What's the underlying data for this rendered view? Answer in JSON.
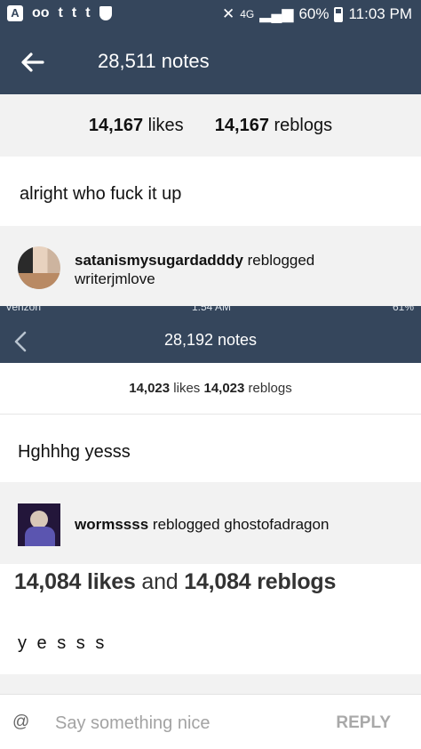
{
  "status_bar": {
    "left_icons": [
      "tumblr-app-icon",
      "voicemail-icon",
      "tumblr-t-icon",
      "tumblr-t-icon",
      "tumblr-t-icon",
      "shield-icon"
    ],
    "network": "4G",
    "battery": "60%",
    "time": "11:03 PM"
  },
  "header1": {
    "title": "28,511 notes"
  },
  "likes1": {
    "likes_count": "14,167",
    "likes_label": "likes",
    "reblogs_count": "14,167",
    "reblogs_label": "reblogs"
  },
  "post1": {
    "text": "alright who fuck it up"
  },
  "reblog1": {
    "user": "satanismysugardadddy",
    "verb": "reblogged",
    "source": "writerjmlove"
  },
  "status_bar2": {
    "carrier": "Verizon",
    "time": "1:54 AM",
    "battery": "61%"
  },
  "header2": {
    "title": "28,192 notes"
  },
  "likes2": {
    "likes_count": "14,023",
    "likes_label": "likes",
    "reblogs_count": "14,023",
    "reblogs_label": "reblogs"
  },
  "post2": {
    "text": "Hghhhg yesss"
  },
  "reblog2": {
    "user": "wormssss",
    "verb": "reblogged",
    "source": "ghostofadragon"
  },
  "likes3": {
    "likes_count": "14,084",
    "likes_label": "likes",
    "and": "and",
    "reblogs_count": "14,084",
    "reblogs_label": "reblogs"
  },
  "post3": {
    "text": "y e s s s"
  },
  "reply": {
    "at": "@",
    "placeholder": "Say something nice",
    "button": "REPLY"
  },
  "colors": {
    "tumblr_navy": "#35465c",
    "light_gray": "#f2f2f2",
    "reply_gray": "#a9a9a9"
  }
}
